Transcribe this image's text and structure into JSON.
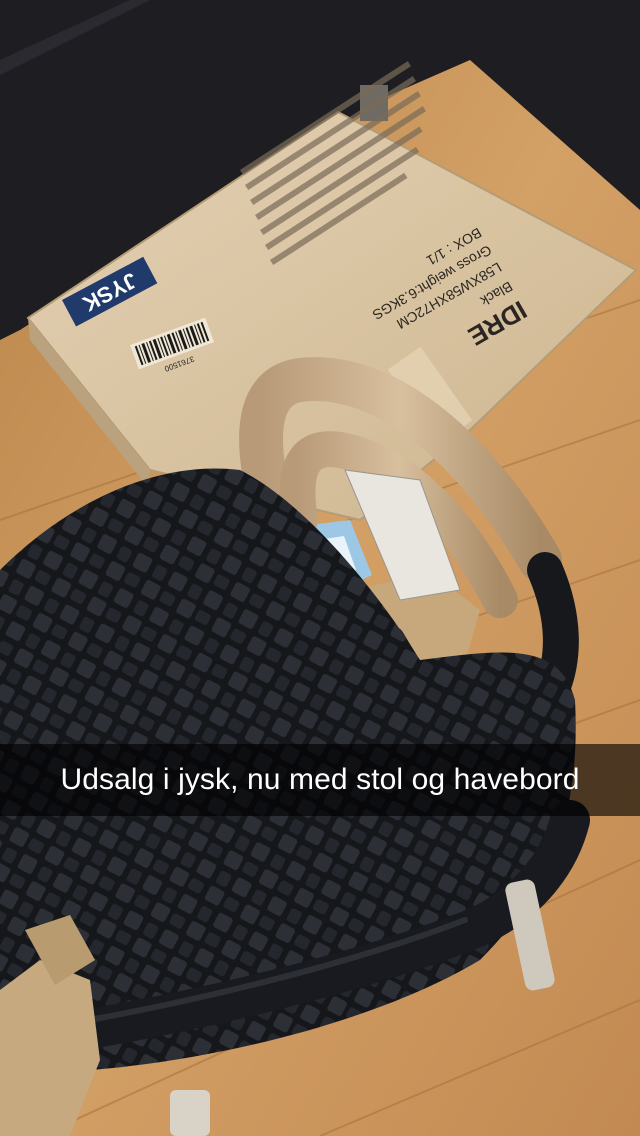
{
  "snap": {
    "caption": "Udsalg i jysk, nu med stol og havebord"
  },
  "box": {
    "brand": "JYSK",
    "product": "IDRE",
    "color": "Black",
    "dimensions": "L58XW58XH72CM",
    "gross_weight": "Gross weight:6.3KGS",
    "box_count": "BOX : 1/1",
    "barcode_number": "3761500"
  },
  "colors": {
    "floor": "#c9935a",
    "cabinet": "#1e1e22",
    "cardboard": "#d8c3a0",
    "chair": "#1d1f24",
    "caption_bar": "#000000",
    "caption_text": "#ffffff"
  }
}
